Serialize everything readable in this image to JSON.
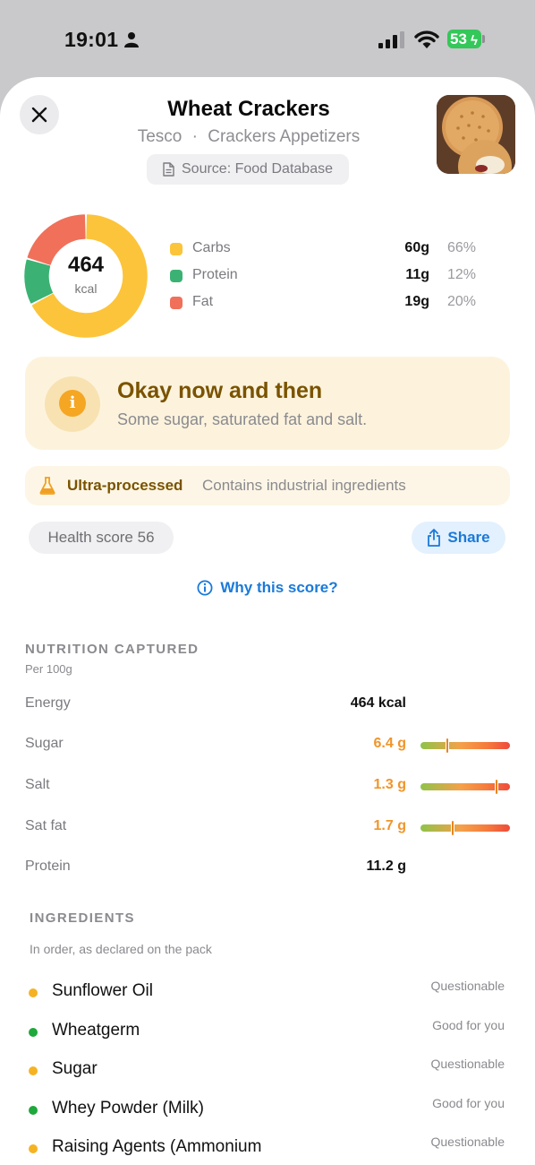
{
  "status": {
    "time": "19:01",
    "battery": "53"
  },
  "product": {
    "name": "Wheat Crackers",
    "brand": "Tesco",
    "separator": "·",
    "category": "Crackers Appetizers",
    "source": "Source: Food Database"
  },
  "macros": {
    "kcal_value": "464",
    "kcal_unit": "kcal",
    "items": [
      {
        "name": "Carbs",
        "grams": "60g",
        "pct": "66%",
        "color": "#fcc43a"
      },
      {
        "name": "Protein",
        "grams": "11g",
        "pct": "12%",
        "color": "#3bb273"
      },
      {
        "name": "Fat",
        "grams": "19g",
        "pct": "20%",
        "color": "#f0705a"
      }
    ]
  },
  "verdict": {
    "title": "Okay now and then",
    "description": "Some sugar, saturated fat and salt."
  },
  "processing": {
    "label": "Ultra-processed",
    "description": "Contains industrial ingredients"
  },
  "health_score": "Health score 56",
  "share_label": "Share",
  "why_label": "Why this score?",
  "nutrition": {
    "title": "NUTRITION CAPTURED",
    "subtitle": "Per 100g",
    "rows": [
      {
        "label": "Energy",
        "value": "464 kcal",
        "level": null
      },
      {
        "label": "Sugar",
        "value": "6.4 g",
        "level": 0.3
      },
      {
        "label": "Salt",
        "value": "1.3 g",
        "level": 0.85
      },
      {
        "label": "Sat fat",
        "value": "1.7 g",
        "level": 0.36
      },
      {
        "label": "Protein",
        "value": "11.2 g",
        "level": null
      }
    ]
  },
  "ingredients": {
    "title": "INGREDIENTS",
    "subtitle": "In order, as declared on the pack",
    "items": [
      {
        "name": "Sunflower Oil",
        "tag": "Questionable",
        "color": "#f5b323"
      },
      {
        "name": "Wheatgerm",
        "tag": "Good for you",
        "color": "#1fa83b"
      },
      {
        "name": "Sugar",
        "tag": "Questionable",
        "color": "#f5b323"
      },
      {
        "name": "Whey Powder (Milk)",
        "tag": "Good for you",
        "color": "#1fa83b"
      },
      {
        "name": "Raising Agents (Ammonium",
        "tag": "Questionable",
        "color": "#f5b323"
      }
    ]
  },
  "colors": {
    "accent_blue": "#1a7ad9",
    "warning_brown": "#7a5300",
    "orange_value": "#f0952a"
  }
}
